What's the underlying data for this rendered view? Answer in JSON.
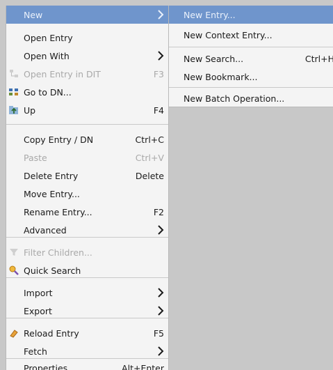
{
  "menu": {
    "items": [
      {
        "label": "New",
        "shortcut": "",
        "submenu": true,
        "icon": "",
        "state": "highlighted"
      },
      {
        "label": "Open Entry",
        "shortcut": "",
        "submenu": false,
        "icon": "",
        "state": "enabled"
      },
      {
        "label": "Open With",
        "shortcut": "",
        "submenu": true,
        "icon": "",
        "state": "enabled"
      },
      {
        "label": "Open Entry in DIT",
        "shortcut": "F3",
        "submenu": false,
        "icon": "dit-icon",
        "state": "disabled"
      },
      {
        "label": "Go to DN...",
        "shortcut": "",
        "submenu": false,
        "icon": "goto-dn-icon",
        "state": "enabled"
      },
      {
        "label": "Up",
        "shortcut": "F4",
        "submenu": false,
        "icon": "up-icon",
        "state": "enabled"
      },
      {
        "label": "Copy Entry / DN",
        "shortcut": "Ctrl+C",
        "submenu": false,
        "icon": "",
        "state": "enabled"
      },
      {
        "label": "Paste",
        "shortcut": "Ctrl+V",
        "submenu": false,
        "icon": "",
        "state": "disabled"
      },
      {
        "label": "Delete Entry",
        "shortcut": "Delete",
        "submenu": false,
        "icon": "",
        "state": "enabled"
      },
      {
        "label": "Move Entry...",
        "shortcut": "",
        "submenu": false,
        "icon": "",
        "state": "enabled"
      },
      {
        "label": "Rename Entry...",
        "shortcut": "F2",
        "submenu": false,
        "icon": "",
        "state": "enabled"
      },
      {
        "label": "Advanced",
        "shortcut": "",
        "submenu": true,
        "icon": "",
        "state": "enabled"
      },
      {
        "label": "Filter Children...",
        "shortcut": "",
        "submenu": false,
        "icon": "filter-icon",
        "state": "disabled"
      },
      {
        "label": "Quick Search",
        "shortcut": "",
        "submenu": false,
        "icon": "quick-search-icon",
        "state": "enabled"
      },
      {
        "label": "Import",
        "shortcut": "",
        "submenu": true,
        "icon": "",
        "state": "enabled"
      },
      {
        "label": "Export",
        "shortcut": "",
        "submenu": true,
        "icon": "",
        "state": "enabled"
      },
      {
        "label": "Reload Entry",
        "shortcut": "F5",
        "submenu": false,
        "icon": "reload-icon",
        "state": "enabled"
      },
      {
        "label": "Fetch",
        "shortcut": "",
        "submenu": true,
        "icon": "",
        "state": "enabled"
      },
      {
        "label": "Properties",
        "shortcut": "Alt+Enter",
        "submenu": false,
        "icon": "",
        "state": "enabled"
      }
    ]
  },
  "submenu": {
    "items": [
      {
        "label": "New Entry...",
        "shortcut": "",
        "state": "highlighted"
      },
      {
        "label": "New Context Entry...",
        "shortcut": "",
        "state": "enabled"
      },
      {
        "label": "New Search...",
        "shortcut": "Ctrl+H",
        "state": "enabled"
      },
      {
        "label": "New Bookmark...",
        "shortcut": "",
        "state": "enabled"
      },
      {
        "label": "New Batch Operation...",
        "shortcut": "",
        "state": "enabled"
      }
    ]
  },
  "colors": {
    "highlight": "#6f95cc",
    "menu_bg": "#f4f4f4",
    "disabled_text": "#a9a9a9",
    "backdrop": "#c8c8c8"
  }
}
